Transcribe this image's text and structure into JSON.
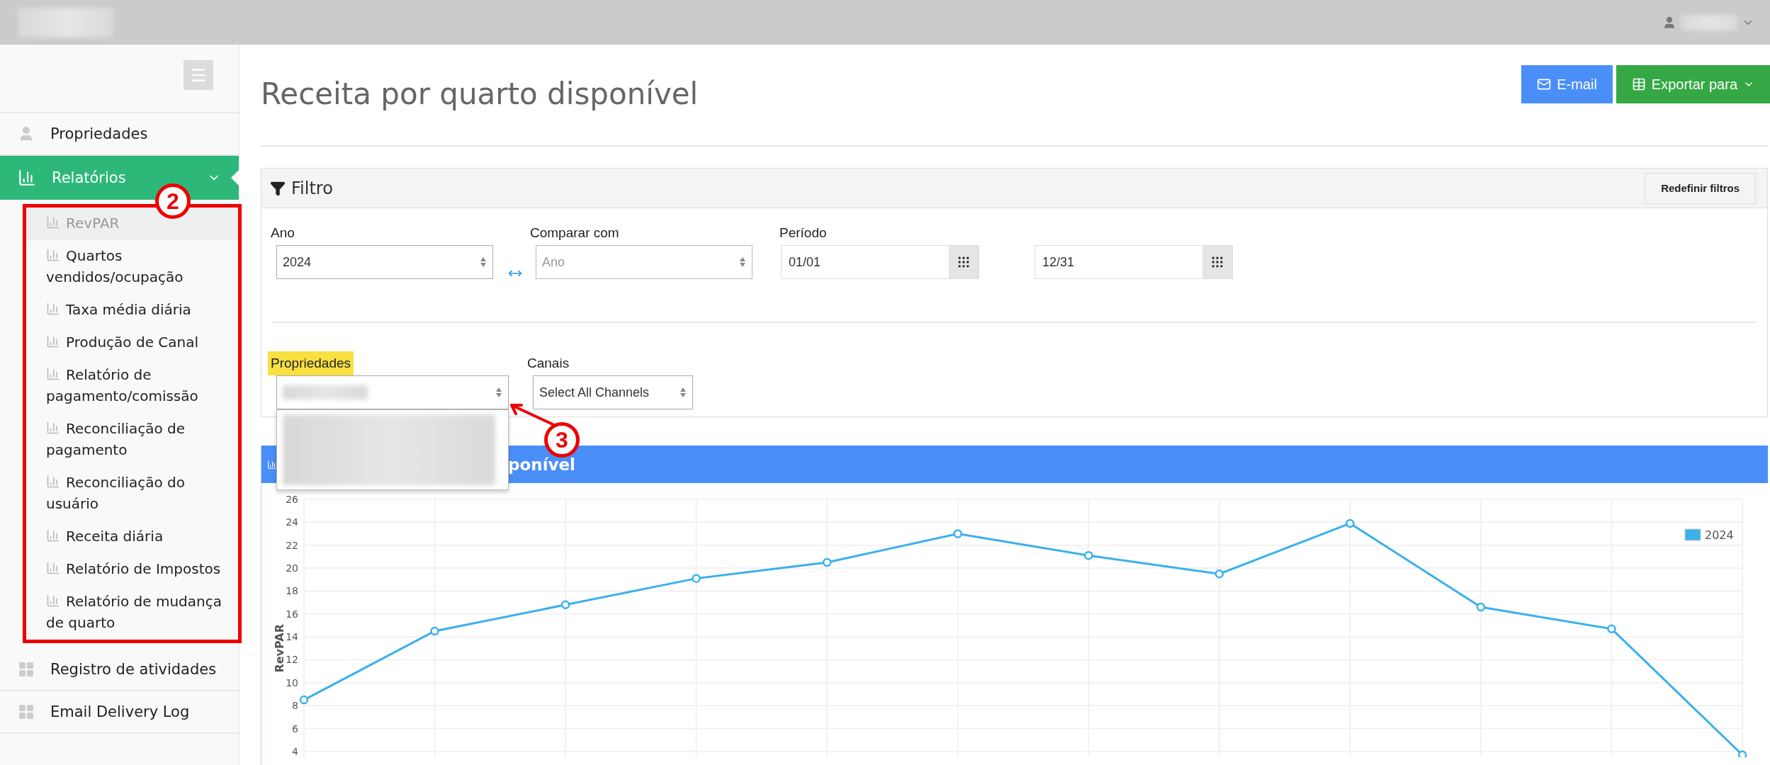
{
  "sidebar": {
    "items": [
      {
        "label": "Propriedades",
        "kind": "user",
        "selected": false
      },
      {
        "label": "Relatórios",
        "kind": "chart",
        "selected": true,
        "expanded": true,
        "children": [
          {
            "label": "RevPAR",
            "selected": true
          },
          {
            "label": "Quartos vendidos/ocupação",
            "selected": false
          },
          {
            "label": "Taxa média diária",
            "selected": false
          },
          {
            "label": "Produção de Canal",
            "selected": false
          },
          {
            "label": "Relatório de pagamento/comissão",
            "selected": false
          },
          {
            "label": "Reconciliação de pagamento",
            "selected": false
          },
          {
            "label": "Reconciliação do usuário",
            "selected": false
          },
          {
            "label": "Receita diária",
            "selected": false
          },
          {
            "label": "Relatório de Impostos",
            "selected": false
          },
          {
            "label": "Relatório de mudança de quarto",
            "selected": false
          }
        ]
      },
      {
        "label": "Registro de atividades",
        "kind": "grid",
        "selected": false
      },
      {
        "label": "Email Delivery Log",
        "kind": "grid",
        "selected": false
      }
    ]
  },
  "page": {
    "title": "Receita por quarto disponível",
    "buttons": [
      {
        "label": "E-mail",
        "kind": "email"
      },
      {
        "label": "Exportar para",
        "kind": "export"
      }
    ]
  },
  "filter": {
    "title": "Filtro",
    "reset_button": "Redefinir filtros",
    "year": {
      "label": "Ano",
      "value": "2024"
    },
    "compare": {
      "label": "Comparar com",
      "placeholder": "Ano",
      "disabled": true
    },
    "period": {
      "label": "Período",
      "start": "01/01",
      "end": "12/31"
    },
    "properties": {
      "label": "Propriedades",
      "highlighted": true,
      "expanded": true
    },
    "channels": {
      "label": "Canais",
      "value": "Select All Channels"
    }
  },
  "chart_panel": {
    "title": "ponível",
    "chart_data": {
      "type": "line",
      "ylabel": "RevPAR",
      "ylim": [
        3.5,
        26
      ],
      "yticks": [
        4,
        6,
        8,
        10,
        12,
        14,
        16,
        18,
        20,
        22,
        24,
        26
      ],
      "grid": true,
      "series": [
        {
          "name": "2024",
          "color": "#3ab0ec",
          "marker": true,
          "values": [
            8.5,
            14.5,
            16.8,
            19.1,
            20.5,
            23.0,
            21.1,
            19.5,
            23.9,
            16.6,
            14.7,
            3.7
          ]
        }
      ]
    }
  },
  "annotations": [
    {
      "label": "2"
    },
    {
      "label": "3"
    }
  ]
}
